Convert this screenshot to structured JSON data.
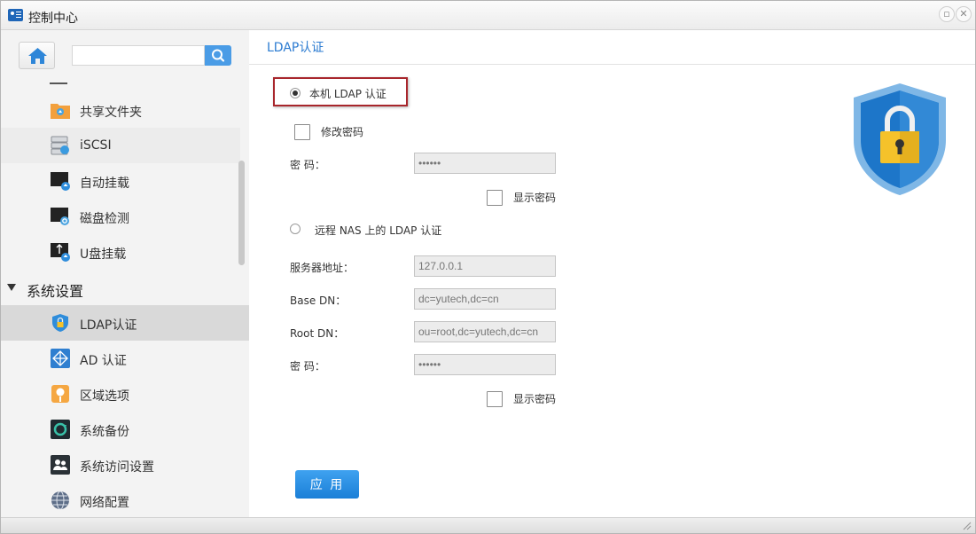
{
  "window": {
    "title": "控制中心"
  },
  "sidebar": {
    "search_placeholder": "",
    "items_above": [
      {
        "label": "共享文件夹",
        "icon": "shared-folder-icon"
      },
      {
        "label": "iSCSI",
        "icon": "iscsi-disk-icon"
      },
      {
        "label": "自动挂载",
        "icon": "auto-mount-icon"
      },
      {
        "label": "磁盘检测",
        "icon": "disk-check-icon"
      },
      {
        "label": "U盘挂载",
        "icon": "usb-mount-icon"
      }
    ],
    "group": {
      "label": "系统设置"
    },
    "items_group": [
      {
        "label": "LDAP认证",
        "icon": "shield-lock-icon",
        "selected": true
      },
      {
        "label": "AD 认证",
        "icon": "ad-network-icon"
      },
      {
        "label": "区域选项",
        "icon": "region-pin-icon"
      },
      {
        "label": "系统备份",
        "icon": "backup-icon"
      },
      {
        "label": "系统访问设置",
        "icon": "access-users-icon"
      },
      {
        "label": "网络配置",
        "icon": "network-globe-icon"
      }
    ]
  },
  "main": {
    "title": "LDAP认证",
    "local": {
      "radio_label": "本机 LDAP 认证",
      "checked": true,
      "change_password_label": "修改密码",
      "password_label": "密 码：",
      "password_value": "••••••",
      "show_password_label": "显示密码"
    },
    "remote": {
      "radio_label": "远程 NAS 上的 LDAP 认证",
      "checked": false,
      "server_label": "服务器地址：",
      "server_value": "127.0.0.1",
      "base_dn_label": "Base DN：",
      "base_dn_value": "dc=yutech,dc=cn",
      "root_dn_label": "Root DN：",
      "root_dn_value": "ou=root,dc=yutech,dc=cn",
      "password_label": "密 码：",
      "password_value": "••••••",
      "show_password_label": "显示密码"
    },
    "apply_label": "应 用"
  },
  "colors": {
    "accent": "#2b7bd1",
    "button": "#2a8de2",
    "highlight_border": "#a8262c",
    "shield_blue": "#1d76c9",
    "lock_yellow": "#f5c22a"
  }
}
